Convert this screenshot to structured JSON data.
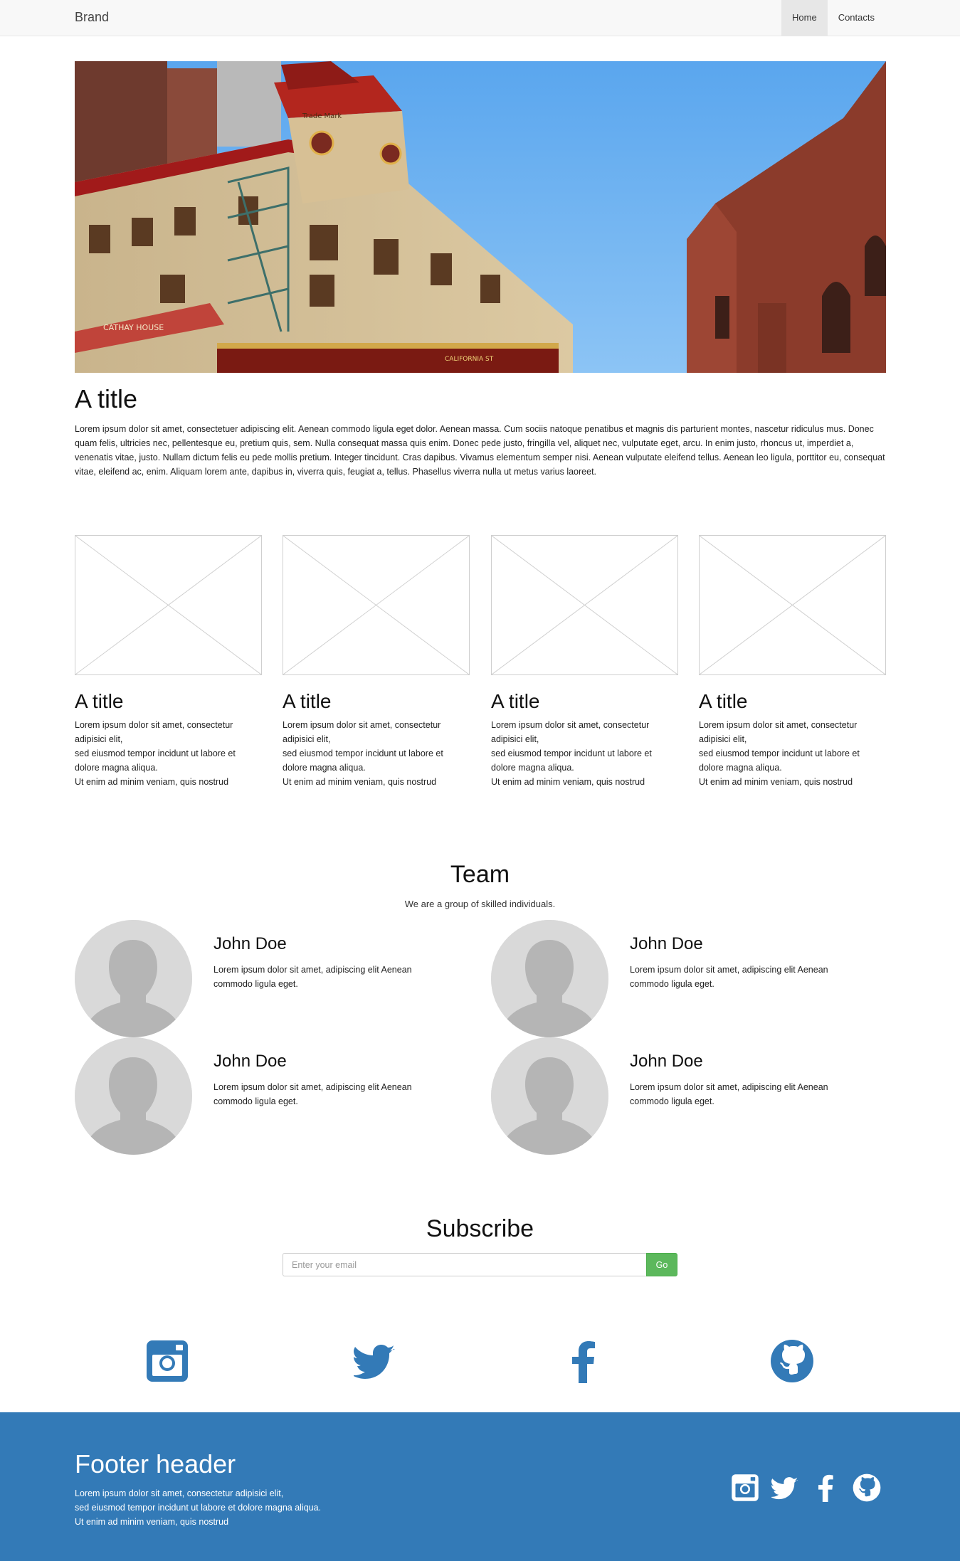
{
  "navbar": {
    "brand": "Brand",
    "items": [
      {
        "label": "Home",
        "active": true
      },
      {
        "label": "Contacts",
        "active": false
      }
    ]
  },
  "hero": {
    "title": "A title",
    "text": "Lorem ipsum dolor sit amet, consectetuer adipiscing elit. Aenean commodo ligula eget dolor. Aenean massa. Cum sociis natoque penatibus et magnis dis parturient montes, nascetur ridiculus mus. Donec quam felis, ultricies nec, pellentesque eu, pretium quis, sem. Nulla consequat massa quis enim. Donec pede justo, fringilla vel, aliquet nec, vulputate eget, arcu. In enim justo, rhoncus ut, imperdiet a, venenatis vitae, justo. Nullam dictum felis eu pede mollis pretium. Integer tincidunt. Cras dapibus. Vivamus elementum semper nisi. Aenean vulputate eleifend tellus. Aenean leo ligula, porttitor eu, consequat vitae, eleifend ac, enim. Aliquam lorem ante, dapibus in, viverra quis, feugiat a, tellus. Phasellus viverra nulla ut metus varius laoreet.",
    "image_signs": {
      "sign1": "Trade Mark",
      "sign2": "CATHAY HOUSE",
      "sign3": "CALIFORNIA ST"
    }
  },
  "features": [
    {
      "title": "A title",
      "lines": [
        "Lorem ipsum dolor sit amet, consectetur adipisici elit,",
        "sed eiusmod tempor incidunt ut labore et dolore magna aliqua.",
        "Ut enim ad minim veniam, quis nostrud"
      ]
    },
    {
      "title": "A title",
      "lines": [
        "Lorem ipsum dolor sit amet, consectetur adipisici elit,",
        "sed eiusmod tempor incidunt ut labore et dolore magna aliqua.",
        "Ut enim ad minim veniam, quis nostrud"
      ]
    },
    {
      "title": "A title",
      "lines": [
        "Lorem ipsum dolor sit amet, consectetur adipisici elit,",
        "sed eiusmod tempor incidunt ut labore et dolore magna aliqua.",
        "Ut enim ad minim veniam, quis nostrud"
      ]
    },
    {
      "title": "A title",
      "lines": [
        "Lorem ipsum dolor sit amet, consectetur adipisici elit,",
        "sed eiusmod tempor incidunt ut labore et dolore magna aliqua.",
        "Ut enim ad minim veniam, quis nostrud"
      ]
    }
  ],
  "team": {
    "title": "Team",
    "subtitle": "We are a group of skilled individuals.",
    "members": [
      {
        "name": "John Doe",
        "text": "Lorem ipsum dolor sit amet, adipiscing elit Aenean commodo ligula eget."
      },
      {
        "name": "John Doe",
        "text": "Lorem ipsum dolor sit amet, adipiscing elit Aenean commodo ligula eget."
      },
      {
        "name": "John Doe",
        "text": "Lorem ipsum dolor sit amet, adipiscing elit Aenean commodo ligula eget."
      },
      {
        "name": "John Doe",
        "text": "Lorem ipsum dolor sit amet, adipiscing elit Aenean commodo ligula eget."
      }
    ]
  },
  "subscribe": {
    "title": "Subscribe",
    "placeholder": "Enter your email",
    "button": "Go"
  },
  "social": [
    "instagram-icon",
    "twitter-icon",
    "facebook-icon",
    "github-icon"
  ],
  "footer": {
    "title": "Footer header",
    "lines": [
      "Lorem ipsum dolor sit amet, consectetur adipisici elit,",
      "sed eiusmod tempor incidunt ut labore et dolore magna aliqua.",
      "Ut enim ad minim veniam, quis nostrud"
    ]
  },
  "colors": {
    "accent": "#337ab7",
    "success": "#5cb85c",
    "navbar_bg": "#f8f8f8"
  }
}
